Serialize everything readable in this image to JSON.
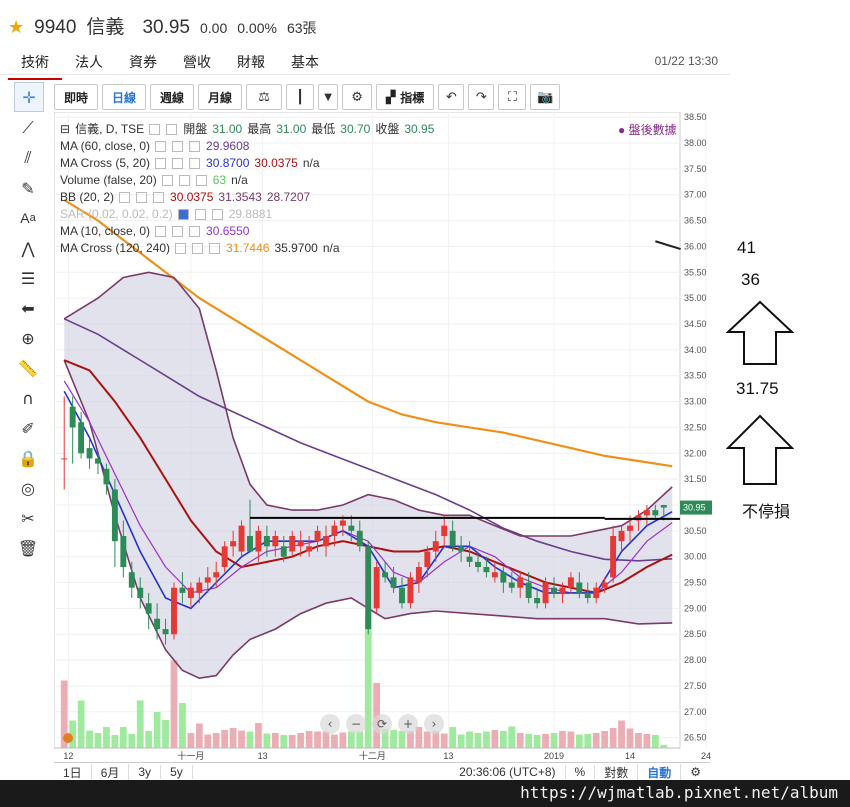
{
  "header": {
    "star": "★",
    "code": "9940",
    "name": "信義",
    "price": "30.95",
    "change": "0.00",
    "pct": "0.00%",
    "volume": "63張"
  },
  "tabs": [
    "技術",
    "法人",
    "資券",
    "營收",
    "財報",
    "基本"
  ],
  "datetime": "01/22 13:30",
  "toolbar": {
    "buttons": [
      "即時",
      "日線",
      "週線",
      "月線"
    ],
    "active": "日線",
    "indicator_label": "指標"
  },
  "legend": [
    {
      "text": "信義, D, TSE",
      "vals": [
        [
          "開盤",
          "31.00"
        ],
        [
          "最高",
          "31.00"
        ],
        [
          "最低",
          "30.70"
        ],
        [
          "收盤",
          "30.95"
        ]
      ]
    },
    {
      "text": "MA (60, close, 0)",
      "v1": "29.9608",
      "c1": "#6a3d8e"
    },
    {
      "text": "MA Cross (5, 20)",
      "v1": "30.8700",
      "c1": "#2233cc",
      "v2": "30.0375",
      "c2": "#aa1111",
      "v3": "n/a"
    },
    {
      "text": "Volume (false, 20)",
      "v1": "63",
      "c1": "#7ed67e",
      "v2": "n/a",
      "c2": "#333"
    },
    {
      "text": "BB (20, 2)",
      "v1": "30.0375",
      "c1": "#aa1111",
      "v2": "31.3543",
      "c2": "#7a3a6a",
      "v3": "28.7207",
      "c3": "#7a3a6a"
    },
    {
      "text": "SAR (0.02, 0.02, 0.2)",
      "v1": "29.8881",
      "c1": "#aaaaaa",
      "dim": true
    },
    {
      "text": "MA (10, close, 0)",
      "v1": "30.6550",
      "c1": "#9933cc"
    },
    {
      "text": "MA Cross (120, 240)",
      "v1": "31.7446",
      "c1": "#f0901a",
      "v2": "35.9700",
      "c2": "#333",
      "v3": "n/a"
    }
  ],
  "after_hours": "● 盤後數據",
  "bottom_bar": {
    "ranges": [
      "1日",
      "6月",
      "3y",
      "5y"
    ],
    "clock": "20:36:06 (UTC+8)",
    "pct": "%",
    "log": "對數",
    "auto": "自動"
  },
  "annotations": {
    "n41": "41",
    "n36": "36",
    "n3175": "31.75",
    "nostop": "不停損"
  },
  "footer_url": "https://wjmatlab.pixnet.net/album",
  "colors": {
    "up": "#e53935",
    "down": "#2e8b57",
    "vol_up": "#e8a0a8",
    "vol_down": "#8ee68e",
    "ma60": "#6a3d8e",
    "ma5": "#2233cc",
    "ma20": "#aa1111",
    "ma10": "#9933cc",
    "ma120": "#f0901a",
    "bb": "#7a3a6a",
    "band": "#cfcfe0"
  },
  "chart_data": {
    "type": "candlestick",
    "ylim": [
      26.3,
      38.6
    ],
    "yticks": [
      26.5,
      27.0,
      27.5,
      28.0,
      28.5,
      29.0,
      29.5,
      30.0,
      30.5,
      31.0,
      31.5,
      32.0,
      32.5,
      33.0,
      33.5,
      34.0,
      34.5,
      35.0,
      35.5,
      36.0,
      36.5,
      37.0,
      37.5,
      38.0,
      38.5
    ],
    "xticks": [
      [
        "12",
        0.5
      ],
      [
        "十一月",
        15
      ],
      [
        "13",
        23.5
      ],
      [
        "十二月",
        36.5
      ],
      [
        "13",
        45.5
      ],
      [
        "2019",
        58
      ],
      [
        "14",
        67
      ],
      [
        "24",
        76
      ]
    ],
    "last_price": "30.95",
    "ohlc": [
      [
        31.9,
        33.1,
        31.3,
        31.9
      ],
      [
        32.9,
        33.1,
        31.8,
        32.5
      ],
      [
        32.6,
        32.8,
        31.9,
        32.0
      ],
      [
        32.1,
        32.3,
        31.7,
        31.9
      ],
      [
        31.9,
        32.0,
        31.6,
        31.8
      ],
      [
        31.7,
        31.8,
        31.2,
        31.4
      ],
      [
        31.3,
        31.5,
        29.8,
        30.3
      ],
      [
        30.4,
        30.7,
        29.6,
        29.8
      ],
      [
        29.7,
        29.9,
        29.2,
        29.4
      ],
      [
        29.4,
        29.6,
        29.0,
        29.2
      ],
      [
        29.1,
        29.3,
        28.6,
        28.9
      ],
      [
        28.8,
        29.1,
        28.4,
        28.6
      ],
      [
        28.6,
        28.8,
        28.3,
        28.5
      ],
      [
        28.5,
        29.5,
        28.4,
        29.4
      ],
      [
        29.4,
        29.7,
        29.1,
        29.3
      ],
      [
        29.2,
        29.5,
        29.0,
        29.4
      ],
      [
        29.3,
        29.6,
        29.1,
        29.5
      ],
      [
        29.5,
        29.8,
        29.3,
        29.6
      ],
      [
        29.6,
        29.9,
        29.4,
        29.7
      ],
      [
        29.8,
        30.3,
        29.7,
        30.2
      ],
      [
        30.2,
        30.5,
        30.0,
        30.3
      ],
      [
        30.1,
        30.7,
        30.0,
        30.6
      ],
      [
        30.4,
        31.1,
        30.3,
        30.1
      ],
      [
        30.1,
        30.6,
        29.9,
        30.5
      ],
      [
        30.4,
        30.6,
        30.0,
        30.2
      ],
      [
        30.2,
        30.5,
        30.0,
        30.4
      ],
      [
        30.2,
        30.4,
        29.9,
        30.0
      ],
      [
        30.1,
        30.5,
        30.0,
        30.4
      ],
      [
        30.2,
        30.5,
        30.0,
        30.3
      ],
      [
        30.1,
        30.4,
        30.0,
        30.2
      ],
      [
        30.3,
        30.6,
        30.1,
        30.5
      ],
      [
        30.2,
        30.6,
        30.0,
        30.4
      ],
      [
        30.4,
        30.7,
        30.2,
        30.6
      ],
      [
        30.6,
        30.8,
        30.4,
        30.7
      ],
      [
        30.6,
        30.8,
        30.3,
        30.5
      ],
      [
        30.5,
        30.7,
        30.1,
        30.2
      ],
      [
        30.2,
        30.3,
        28.5,
        28.6
      ],
      [
        29.0,
        29.9,
        28.9,
        29.8
      ],
      [
        29.7,
        29.9,
        29.5,
        29.6
      ],
      [
        29.6,
        29.8,
        29.3,
        29.4
      ],
      [
        29.4,
        29.6,
        29.0,
        29.1
      ],
      [
        29.1,
        29.7,
        29.0,
        29.6
      ],
      [
        29.5,
        29.9,
        29.3,
        29.8
      ],
      [
        29.8,
        30.2,
        29.6,
        30.1
      ],
      [
        30.1,
        30.5,
        29.9,
        30.3
      ],
      [
        30.4,
        30.8,
        30.2,
        30.6
      ],
      [
        30.5,
        30.7,
        30.1,
        30.2
      ],
      [
        30.2,
        30.4,
        29.9,
        30.1
      ],
      [
        30.0,
        30.3,
        29.8,
        29.9
      ],
      [
        29.9,
        30.1,
        29.7,
        29.8
      ],
      [
        29.8,
        30.0,
        29.6,
        29.7
      ],
      [
        29.6,
        29.9,
        29.5,
        29.7
      ],
      [
        29.7,
        29.8,
        29.3,
        29.5
      ],
      [
        29.5,
        29.7,
        29.3,
        29.4
      ],
      [
        29.4,
        29.7,
        29.2,
        29.6
      ],
      [
        29.5,
        29.7,
        29.1,
        29.2
      ],
      [
        29.2,
        29.4,
        29.0,
        29.1
      ],
      [
        29.1,
        29.6,
        29.0,
        29.5
      ],
      [
        29.4,
        29.6,
        29.2,
        29.3
      ],
      [
        29.3,
        29.5,
        29.1,
        29.4
      ],
      [
        29.4,
        29.7,
        29.3,
        29.6
      ],
      [
        29.5,
        29.7,
        29.2,
        29.3
      ],
      [
        29.3,
        29.5,
        29.1,
        29.2
      ],
      [
        29.2,
        29.5,
        29.1,
        29.4
      ],
      [
        29.4,
        29.6,
        29.3,
        29.5
      ],
      [
        29.6,
        30.6,
        29.5,
        30.4
      ],
      [
        30.3,
        30.6,
        30.1,
        30.5
      ],
      [
        30.5,
        30.8,
        30.3,
        30.6
      ],
      [
        30.7,
        30.9,
        30.5,
        30.8
      ],
      [
        30.8,
        31.0,
        30.6,
        30.9
      ],
      [
        30.9,
        31.0,
        30.7,
        30.8
      ],
      [
        31.0,
        31.0,
        30.7,
        30.95
      ]
    ],
    "volume": [
      1350,
      550,
      950,
      350,
      300,
      420,
      260,
      420,
      280,
      950,
      340,
      720,
      560,
      1750,
      900,
      300,
      490,
      270,
      300,
      360,
      400,
      350,
      330,
      500,
      290,
      300,
      260,
      260,
      300,
      340,
      330,
      330,
      270,
      310,
      330,
      330,
      2750,
      1300,
      380,
      360,
      340,
      340,
      420,
      330,
      340,
      290,
      420,
      270,
      330,
      300,
      330,
      360,
      340,
      430,
      300,
      280,
      260,
      280,
      300,
      340,
      330,
      270,
      280,
      300,
      340,
      400,
      550,
      390,
      300,
      280,
      260,
      63
    ],
    "ma120": [
      [
        0,
        36.9
      ],
      [
        4,
        36.5
      ],
      [
        8,
        36.0
      ],
      [
        12,
        35.5
      ],
      [
        16,
        35.0
      ],
      [
        20,
        34.6
      ],
      [
        24,
        34.2
      ],
      [
        28,
        33.8
      ],
      [
        32,
        33.4
      ],
      [
        36,
        33.0
      ],
      [
        40,
        32.75
      ],
      [
        44,
        32.6
      ],
      [
        48,
        32.5
      ],
      [
        52,
        32.4
      ],
      [
        56,
        32.25
      ],
      [
        60,
        32.1
      ],
      [
        64,
        31.95
      ],
      [
        68,
        31.85
      ],
      [
        72,
        31.75
      ]
    ],
    "ma60": [
      [
        0,
        34.6
      ],
      [
        4,
        34.3
      ],
      [
        8,
        33.9
      ],
      [
        12,
        33.5
      ],
      [
        16,
        33.1
      ],
      [
        20,
        32.8
      ],
      [
        24,
        32.5
      ],
      [
        28,
        32.2
      ],
      [
        32,
        31.95
      ],
      [
        36,
        31.7
      ],
      [
        40,
        31.45
      ],
      [
        44,
        31.2
      ],
      [
        48,
        30.9
      ],
      [
        52,
        30.55
      ],
      [
        56,
        30.3
      ],
      [
        60,
        30.1
      ],
      [
        64,
        29.95
      ],
      [
        68,
        29.92
      ],
      [
        72,
        29.96
      ]
    ],
    "ma20": [
      [
        0,
        33.8
      ],
      [
        3,
        33.6
      ],
      [
        6,
        33.0
      ],
      [
        9,
        32.3
      ],
      [
        12,
        31.5
      ],
      [
        15,
        30.7
      ],
      [
        18,
        30.1
      ],
      [
        21,
        29.8
      ],
      [
        24,
        29.9
      ],
      [
        27,
        30.0
      ],
      [
        30,
        30.2
      ],
      [
        33,
        30.3
      ],
      [
        36,
        30.2
      ],
      [
        39,
        30.1
      ],
      [
        42,
        30.1
      ],
      [
        45,
        30.2
      ],
      [
        48,
        30.1
      ],
      [
        51,
        29.9
      ],
      [
        54,
        29.7
      ],
      [
        57,
        29.5
      ],
      [
        60,
        29.4
      ],
      [
        63,
        29.3
      ],
      [
        66,
        29.5
      ],
      [
        69,
        29.8
      ],
      [
        72,
        30.04
      ]
    ],
    "ma10": [
      [
        0,
        33.4
      ],
      [
        3,
        32.6
      ],
      [
        6,
        31.6
      ],
      [
        9,
        30.6
      ],
      [
        12,
        29.8
      ],
      [
        15,
        29.3
      ],
      [
        18,
        29.4
      ],
      [
        21,
        29.8
      ],
      [
        24,
        30.1
      ],
      [
        27,
        30.2
      ],
      [
        30,
        30.3
      ],
      [
        33,
        30.5
      ],
      [
        36,
        30.3
      ],
      [
        39,
        29.7
      ],
      [
        42,
        29.5
      ],
      [
        45,
        29.9
      ],
      [
        48,
        30.2
      ],
      [
        51,
        30.0
      ],
      [
        54,
        29.6
      ],
      [
        57,
        29.4
      ],
      [
        60,
        29.3
      ],
      [
        63,
        29.3
      ],
      [
        66,
        29.7
      ],
      [
        69,
        30.3
      ],
      [
        72,
        30.66
      ]
    ],
    "ma5": [
      [
        0,
        33.2
      ],
      [
        3,
        32.3
      ],
      [
        6,
        31.2
      ],
      [
        9,
        30.1
      ],
      [
        12,
        29.2
      ],
      [
        15,
        29.0
      ],
      [
        18,
        29.5
      ],
      [
        21,
        30.0
      ],
      [
        24,
        30.3
      ],
      [
        27,
        30.3
      ],
      [
        30,
        30.3
      ],
      [
        33,
        30.5
      ],
      [
        36,
        30.2
      ],
      [
        39,
        29.4
      ],
      [
        42,
        29.5
      ],
      [
        45,
        30.2
      ],
      [
        48,
        30.2
      ],
      [
        51,
        29.8
      ],
      [
        54,
        29.5
      ],
      [
        57,
        29.3
      ],
      [
        60,
        29.3
      ],
      [
        63,
        29.3
      ],
      [
        66,
        30.1
      ],
      [
        69,
        30.6
      ],
      [
        72,
        30.87
      ]
    ],
    "bb_upper": [
      [
        0,
        34.6
      ],
      [
        4,
        35.0
      ],
      [
        7,
        35.4
      ],
      [
        10,
        35.5
      ],
      [
        13,
        35.4
      ],
      [
        16,
        34.8
      ],
      [
        18,
        33.6
      ],
      [
        20,
        32.3
      ],
      [
        22,
        31.4
      ],
      [
        24,
        31.0
      ],
      [
        27,
        30.9
      ],
      [
        30,
        30.9
      ],
      [
        33,
        31.0
      ],
      [
        36,
        31.2
      ],
      [
        39,
        31.1
      ],
      [
        42,
        30.9
      ],
      [
        45,
        30.8
      ],
      [
        48,
        30.8
      ],
      [
        51,
        30.6
      ],
      [
        54,
        30.4
      ],
      [
        57,
        30.4
      ],
      [
        60,
        30.4
      ],
      [
        63,
        30.5
      ],
      [
        66,
        30.6
      ],
      [
        69,
        30.9
      ],
      [
        72,
        31.35
      ]
    ],
    "bb_lower": [
      [
        0,
        33.8
      ],
      [
        3,
        32.6
      ],
      [
        6,
        30.8
      ],
      [
        9,
        29.2
      ],
      [
        12,
        28.2
      ],
      [
        14,
        27.8
      ],
      [
        16,
        27.65
      ],
      [
        18,
        27.7
      ],
      [
        20,
        28.1
      ],
      [
        22,
        28.4
      ],
      [
        25,
        28.6
      ],
      [
        28,
        28.9
      ],
      [
        31,
        29.1
      ],
      [
        34,
        29.2
      ],
      [
        36,
        29.0
      ],
      [
        38,
        28.8
      ],
      [
        41,
        28.9
      ],
      [
        44,
        28.95
      ],
      [
        48,
        28.9
      ],
      [
        52,
        28.85
      ],
      [
        56,
        28.8
      ],
      [
        60,
        28.8
      ],
      [
        64,
        28.8
      ],
      [
        68,
        28.7
      ],
      [
        72,
        28.72
      ]
    ],
    "hline": [
      [
        22,
        30.75
      ],
      [
        64,
        30.75
      ]
    ],
    "hline2": [
      [
        64,
        30.73
      ],
      [
        72,
        30.73
      ]
    ],
    "trend": [
      [
        70,
        36.1
      ],
      [
        73,
        35.95
      ]
    ]
  }
}
